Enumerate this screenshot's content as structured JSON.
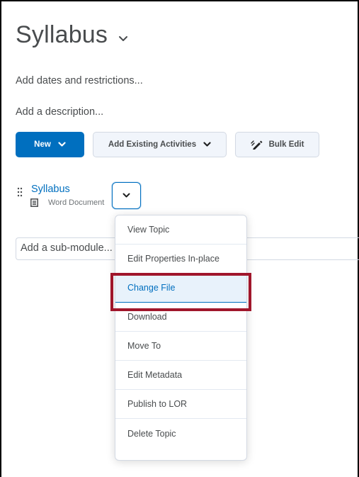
{
  "module": {
    "title": "Syllabus",
    "add_dates_label": "Add dates and restrictions...",
    "add_description_label": "Add a description..."
  },
  "toolbar": {
    "new_label": "New",
    "add_existing_label": "Add Existing Activities",
    "bulk_edit_label": "Bulk Edit"
  },
  "topic": {
    "title": "Syllabus",
    "type": "Word Document"
  },
  "submodule": {
    "placeholder": "Add a sub-module..."
  },
  "context_menu": {
    "items": [
      {
        "label": "View Topic"
      },
      {
        "label": "Edit Properties In-place"
      },
      {
        "label": "Change File",
        "active": true
      },
      {
        "label": "Download"
      },
      {
        "label": "Move To"
      },
      {
        "label": "Edit Metadata"
      },
      {
        "label": "Publish to LOR"
      },
      {
        "label": "Delete Topic"
      }
    ]
  },
  "colors": {
    "primary": "#006fbf",
    "text": "#494c4e",
    "highlight_border": "#a0162b",
    "button_bg": "#f1f5fb"
  },
  "icons": {
    "title_chevron": "chevron-down-icon",
    "drag_handle": "drag-handle-icon",
    "document": "document-icon",
    "bulk_edit": "pencil-icon"
  }
}
